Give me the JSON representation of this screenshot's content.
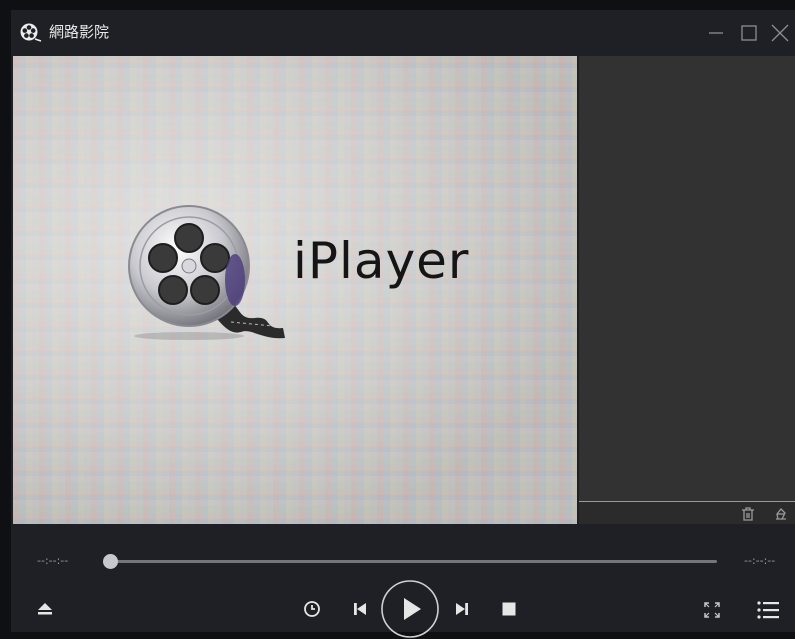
{
  "window": {
    "title": "網路影院"
  },
  "video": {
    "brand_text": "iPlayer"
  },
  "controls": {
    "time_current": "--:--:--",
    "time_total": "--:--:--",
    "progress": 0
  },
  "icons": {
    "app": "film-reel-icon",
    "minimize": "minimize-icon",
    "maximize": "maximize-icon",
    "close": "close-icon",
    "delete": "trash-icon",
    "clear": "eraser-icon",
    "eject": "eject-icon",
    "timer": "clock-icon",
    "previous": "skip-previous-icon",
    "play": "play-icon",
    "next": "skip-next-icon",
    "stop": "stop-icon",
    "fullscreen": "fullscreen-icon",
    "playlist": "playlist-icon"
  },
  "colors": {
    "background": "#1f2026",
    "panel": "#323232",
    "accent": "#e6e6e6"
  }
}
